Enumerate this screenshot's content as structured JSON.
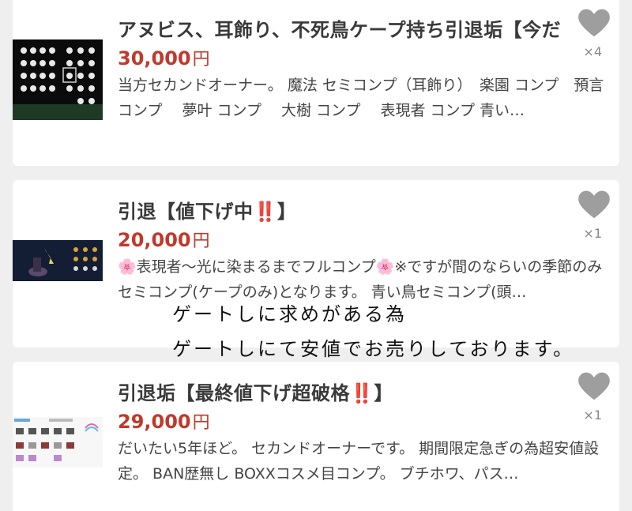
{
  "listings": [
    {
      "title": "アヌビス、耳飾り、不死鳥ケープ持ち引退垢【今だ",
      "price": "30,000",
      "currency": "円",
      "description": "当方セカンドオーナー。 魔法 セミコンプ（耳飾り）　楽園 コンプ　預言 コンプ　 夢叶 コンプ　 大樹 コンプ　 表現者 コンプ 青い…",
      "likes": "×4",
      "heart_icon": "heart-icon"
    },
    {
      "title": "引退【値下げ中‼️】",
      "price": "20,000",
      "currency": "円",
      "description": "🌸表現者〜光に染まるまでフルコンプ🌸※ですが間のならいの季節のみセミコンプ(ケープのみ)となります。 青い鳥セミコンプ(頭…",
      "likes": "×1",
      "heart_icon": "heart-icon"
    },
    {
      "title": "引退垢【最終値下げ超破格‼️】",
      "price": "29,000",
      "currency": "円",
      "description": "だいたい5年ほど。 セカンドオーナーです。 期間限定急ぎの為超安値設定。 BAN歴無し BOXXコスメ目コンプ。 ブチホワ、パス…",
      "likes": "×1",
      "heart_icon": "heart-icon"
    }
  ],
  "overlay_text": {
    "line1": "ゲートしに求めがある為",
    "line2": "ゲートしにて安値でお売りしております。"
  },
  "colors": {
    "price": "#c0392b",
    "heart": "#9e9e9e",
    "background": "#efefef"
  }
}
